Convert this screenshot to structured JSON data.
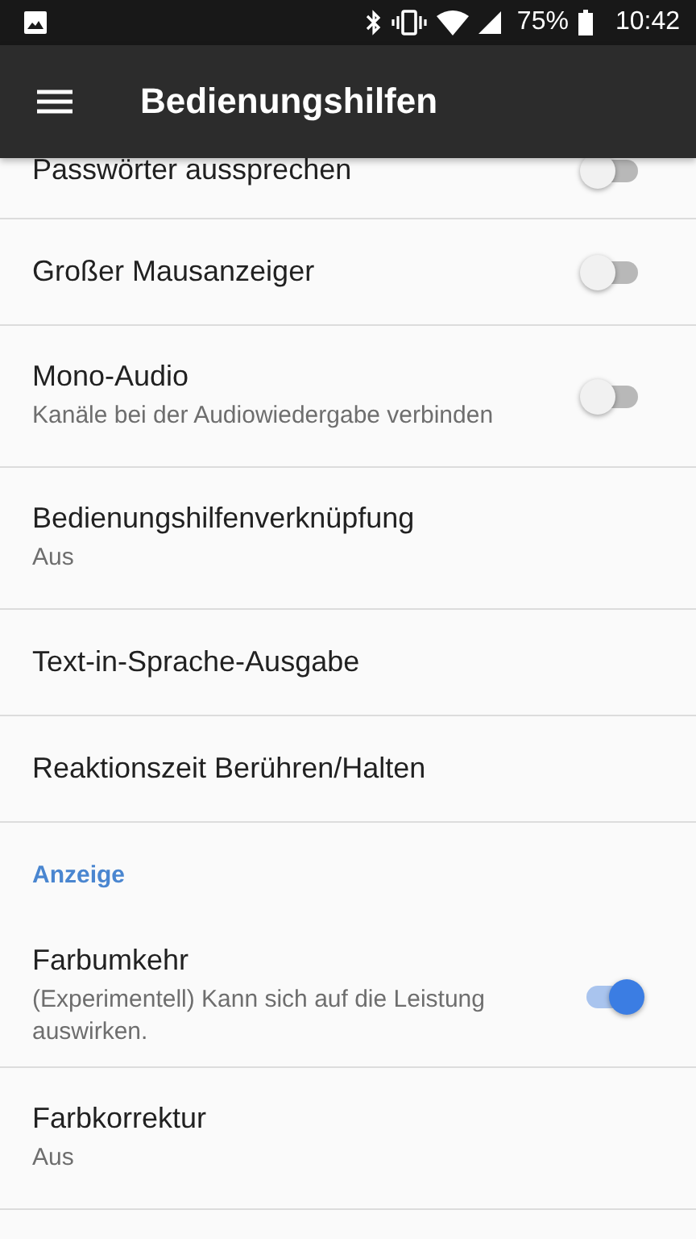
{
  "status_bar": {
    "battery": "75%",
    "time": "10:42"
  },
  "app_bar": {
    "title": "Bedienungshilfen"
  },
  "items": [
    {
      "kind": "toggle",
      "title": "Passwörter aussprechen",
      "on": false
    },
    {
      "kind": "toggle",
      "title": "Großer Mausanzeiger",
      "on": false
    },
    {
      "kind": "toggle",
      "title": "Mono-Audio",
      "summary": "Kanäle bei der Audiowiedergabe verbinden",
      "on": false
    },
    {
      "kind": "plain",
      "title": "Bedienungshilfenverknüpfung",
      "summary": "Aus"
    },
    {
      "kind": "plain",
      "title": "Text-in-Sprache-Ausgabe"
    },
    {
      "kind": "plain",
      "title": "Reaktionszeit Berühren/Halten"
    },
    {
      "kind": "header",
      "title": "Anzeige"
    },
    {
      "kind": "toggle",
      "title": "Farbumkehr",
      "summary": "(Experimentell) Kann sich auf die Leistung auswirken.",
      "on": true
    },
    {
      "kind": "plain",
      "title": "Farbkorrektur",
      "summary": "Aus"
    }
  ]
}
